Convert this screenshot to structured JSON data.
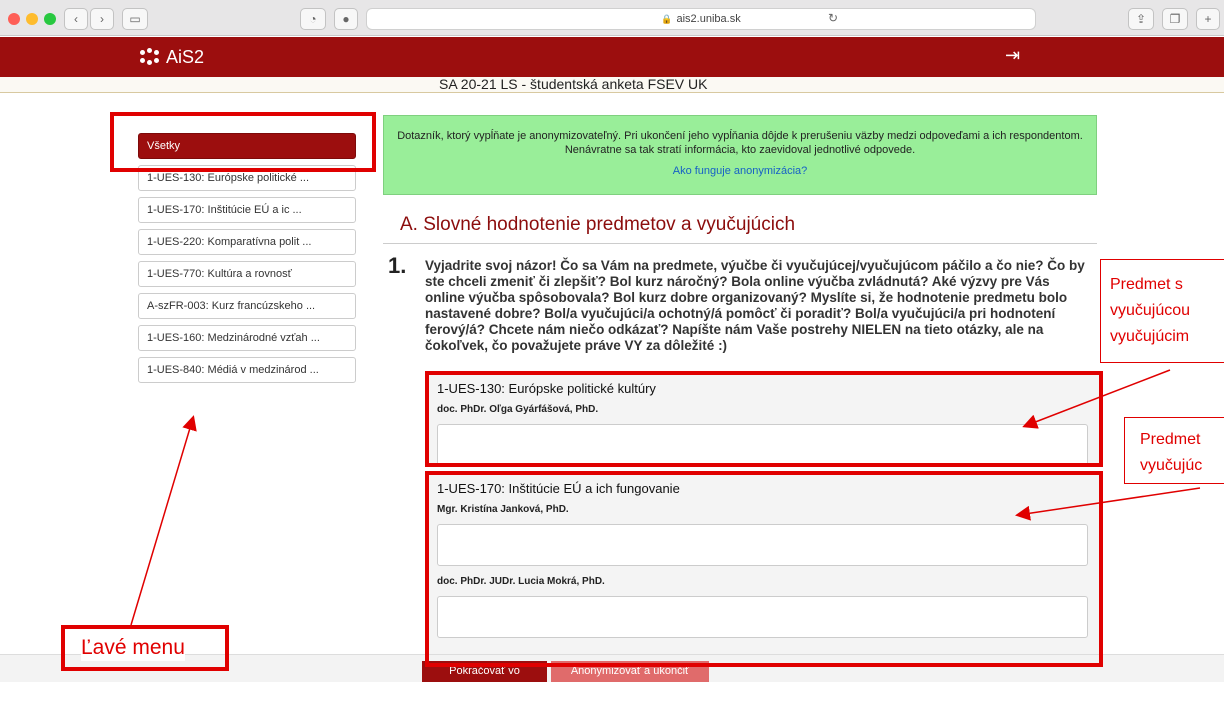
{
  "browser": {
    "url": "ais2.uniba.sk"
  },
  "app": {
    "name": "AiS2"
  },
  "survey": {
    "title": "SA 20-21 LS - študentská anketa FSEV UK"
  },
  "sidebar": {
    "items": [
      {
        "label": "Všetky"
      },
      {
        "label": "1-UES-130: Európske politické ..."
      },
      {
        "label": "1-UES-170: Inštitúcie EÚ a ic ..."
      },
      {
        "label": "1-UES-220: Komparatívna polit ..."
      },
      {
        "label": "1-UES-770: Kultúra a rovnosť"
      },
      {
        "label": "A-szFR-003: Kurz francúzskeho ..."
      },
      {
        "label": "1-UES-160: Medzinárodné vzťah ..."
      },
      {
        "label": "1-UES-840: Médiá v medzinárod ..."
      }
    ]
  },
  "notice": {
    "text": "Dotazník, ktorý vypĺňate je anonymizovateľný. Pri ukončení jeho vypĺňania dôjde k prerušeniu väzby medzi odpoveďami a ich respondentom. Nenávratne sa tak stratí informácia, kto zaevidoval jednotlivé odpovede.",
    "link": "Ako funguje anonymizácia?"
  },
  "section": {
    "heading": "A. Slovné hodnotenie predmetov a vyučujúcich",
    "question_number": "1.",
    "question_text": "Vyjadrite svoj názor! Čo sa Vám na predmete, výučbe či vyučujúcej/vyučujúcom páčilo a čo nie? Čo by ste chceli zmeniť či zlepšiť? Bol kurz náročný? Bola online výučba zvládnutá? Aké výzvy pre Vás online výučba spôsobovala? Bol kurz dobre organizovaný? Myslíte si, že hodnotenie predmetu bolo nastavené dobre? Bol/a vyučujúci/a ochotný/á pomôcť či poradiť? Bol/a vyučujúci/a pri hodnotení ferový/á? Chcete nám niečo odkázať? Napíšte nám Vaše postrehy NIELEN na tieto otázky, ale na čokoľvek, čo považujete práve VY za dôležité :)"
  },
  "courses": [
    {
      "title": "1-UES-130: Európske politické kultúry",
      "teachers": [
        "doc. PhDr. Oľga Gyárfášová, PhD."
      ]
    },
    {
      "title": "1-UES-170: Inštitúcie EÚ a ich fungovanie",
      "teachers": [
        "Mgr. Kristína Janková, PhD.",
        "doc. PhDr. JUDr. Lucia Mokrá, PhD."
      ]
    }
  ],
  "annotations": {
    "left_menu": "Ľavé menu",
    "callout1_lines": [
      "Predmet s",
      "vyučujúcou",
      "vyučujúcim"
    ],
    "callout2_lines": [
      "Predmet",
      "vyučujúc"
    ]
  },
  "footer": {
    "continue_later": "Pokračovať vo vypĺňaní neskôr",
    "anonymize_finish": "Anonymizovať a ukončiť vypĺňanie"
  },
  "colors": {
    "brand": "#9c0e0e",
    "annotation": "#e00000",
    "notice_bg": "#99ee99"
  }
}
